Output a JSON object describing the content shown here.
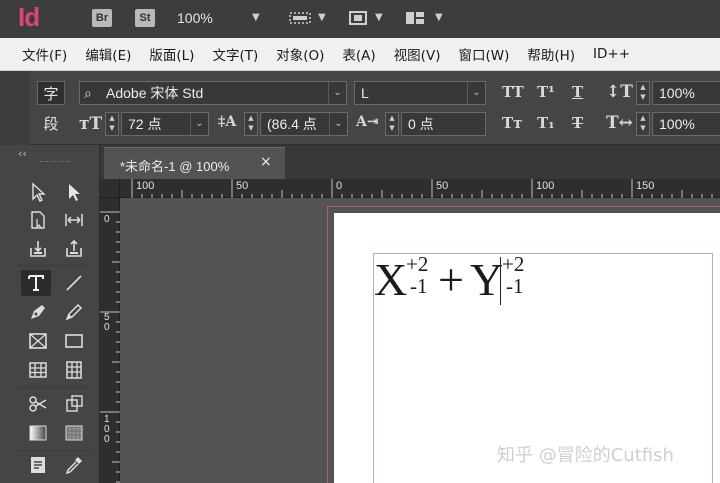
{
  "app": {
    "logo": "Id",
    "bridge_label": "Br",
    "stock_label": "St",
    "zoom": "100%"
  },
  "menu": [
    "文件(F)",
    "编辑(E)",
    "版面(L)",
    "文字(T)",
    "对象(O)",
    "表(A)",
    "视图(V)",
    "窗口(W)",
    "帮助(H)",
    "ID++"
  ],
  "control_panel": {
    "char_tab": "字",
    "para_tab": "段",
    "font_family": "Adobe 宋体 Std",
    "font_style": "L",
    "font_size": "72 点",
    "leading": "(86.4 点",
    "tracking": "0 点",
    "vertical_scale": "100%",
    "horizontal_scale": "100%",
    "all_caps_glyph": "TT",
    "superscript_glyph": "T¹",
    "underline_glyph": "T",
    "small_caps_glyph": "Tᴛ",
    "subscript_glyph": "T₁",
    "strikethrough_glyph": "T"
  },
  "tools_panel": {
    "collapse_glyph": "‹‹"
  },
  "document": {
    "tab_title": "*未命名-1 @ 100%",
    "close_glyph": "×"
  },
  "rulers": {
    "horizontal_labels": [
      "100",
      "50",
      "0",
      "50",
      "100",
      "150"
    ],
    "vertical_labels": [
      "0",
      "5 0",
      "1 0 0"
    ]
  },
  "formula": {
    "base1": "X",
    "sup1": "+2",
    "sub1": "-1",
    "op": "+",
    "base2": "Y",
    "sup2": "+2",
    "sub2": "-1"
  },
  "watermark": "知乎 @冒险的Cutfish",
  "colors": {
    "logo": "#d9457a",
    "bleed": "#b35a7c",
    "margin": "#c3a3c4",
    "panel": "#454545",
    "pasteboard": "#535353"
  }
}
